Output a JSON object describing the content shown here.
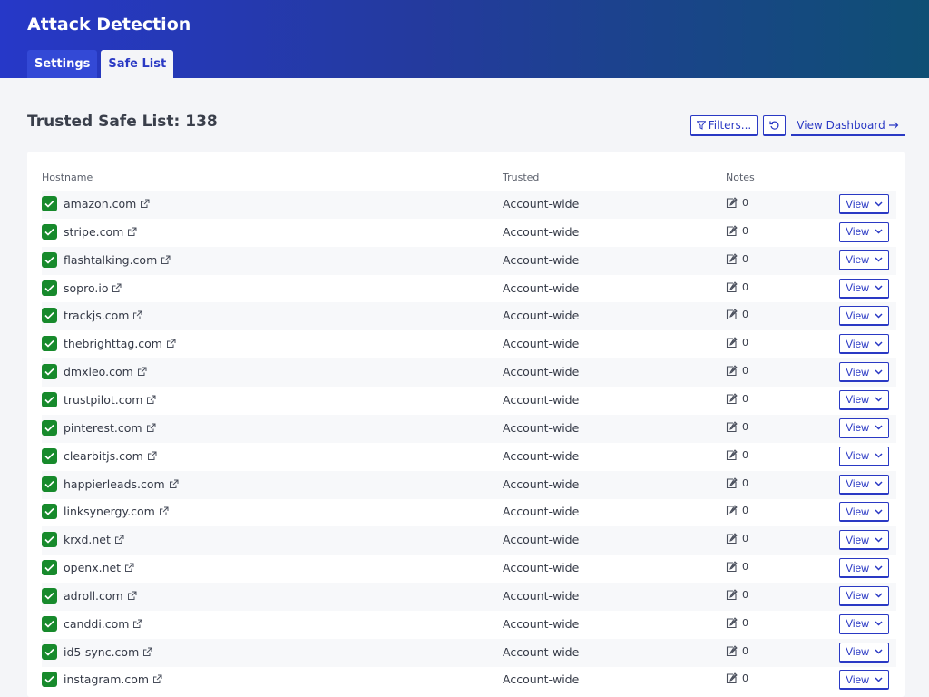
{
  "app": {
    "title": "Attack Detection"
  },
  "tabs": [
    {
      "label": "Settings"
    },
    {
      "label": "Safe List"
    }
  ],
  "toolbar": {
    "title": "Trusted Safe List: 138",
    "filters_label": "Filters...",
    "dashboard_label": "View Dashboard"
  },
  "table": {
    "headers": {
      "hostname": "Hostname",
      "trusted": "Trusted",
      "notes": "Notes"
    },
    "rows": [
      {
        "hostname": "amazon.com",
        "trusted": "Account-wide",
        "notes": "0",
        "action": "View"
      },
      {
        "hostname": "stripe.com",
        "trusted": "Account-wide",
        "notes": "0",
        "action": "View"
      },
      {
        "hostname": "flashtalking.com",
        "trusted": "Account-wide",
        "notes": "0",
        "action": "View"
      },
      {
        "hostname": "sopro.io",
        "trusted": "Account-wide",
        "notes": "0",
        "action": "View"
      },
      {
        "hostname": "trackjs.com",
        "trusted": "Account-wide",
        "notes": "0",
        "action": "View"
      },
      {
        "hostname": "thebrighttag.com",
        "trusted": "Account-wide",
        "notes": "0",
        "action": "View"
      },
      {
        "hostname": "dmxleo.com",
        "trusted": "Account-wide",
        "notes": "0",
        "action": "View"
      },
      {
        "hostname": "trustpilot.com",
        "trusted": "Account-wide",
        "notes": "0",
        "action": "View"
      },
      {
        "hostname": "pinterest.com",
        "trusted": "Account-wide",
        "notes": "0",
        "action": "View"
      },
      {
        "hostname": "clearbitjs.com",
        "trusted": "Account-wide",
        "notes": "0",
        "action": "View"
      },
      {
        "hostname": "happierleads.com",
        "trusted": "Account-wide",
        "notes": "0",
        "action": "View"
      },
      {
        "hostname": "linksynergy.com",
        "trusted": "Account-wide",
        "notes": "0",
        "action": "View"
      },
      {
        "hostname": "krxd.net",
        "trusted": "Account-wide",
        "notes": "0",
        "action": "View"
      },
      {
        "hostname": "openx.net",
        "trusted": "Account-wide",
        "notes": "0",
        "action": "View"
      },
      {
        "hostname": "adroll.com",
        "trusted": "Account-wide",
        "notes": "0",
        "action": "View"
      },
      {
        "hostname": "canddi.com",
        "trusted": "Account-wide",
        "notes": "0",
        "action": "View"
      },
      {
        "hostname": "id5-sync.com",
        "trusted": "Account-wide",
        "notes": "0",
        "action": "View"
      },
      {
        "hostname": "instagram.com",
        "trusted": "Account-wide",
        "notes": "0",
        "action": "View"
      }
    ]
  },
  "colors": {
    "accent": "#2a39c4",
    "check": "#178a2c",
    "header_start": "#2638c8",
    "header_end": "#0f4f74"
  },
  "icons": {
    "filter": "filter-icon",
    "refresh": "refresh-icon",
    "arrow": "arrow-right-icon",
    "external": "external-link-icon",
    "notes": "edit-note-icon",
    "chevron": "chevron-down-icon",
    "check": "checkmark-icon"
  }
}
